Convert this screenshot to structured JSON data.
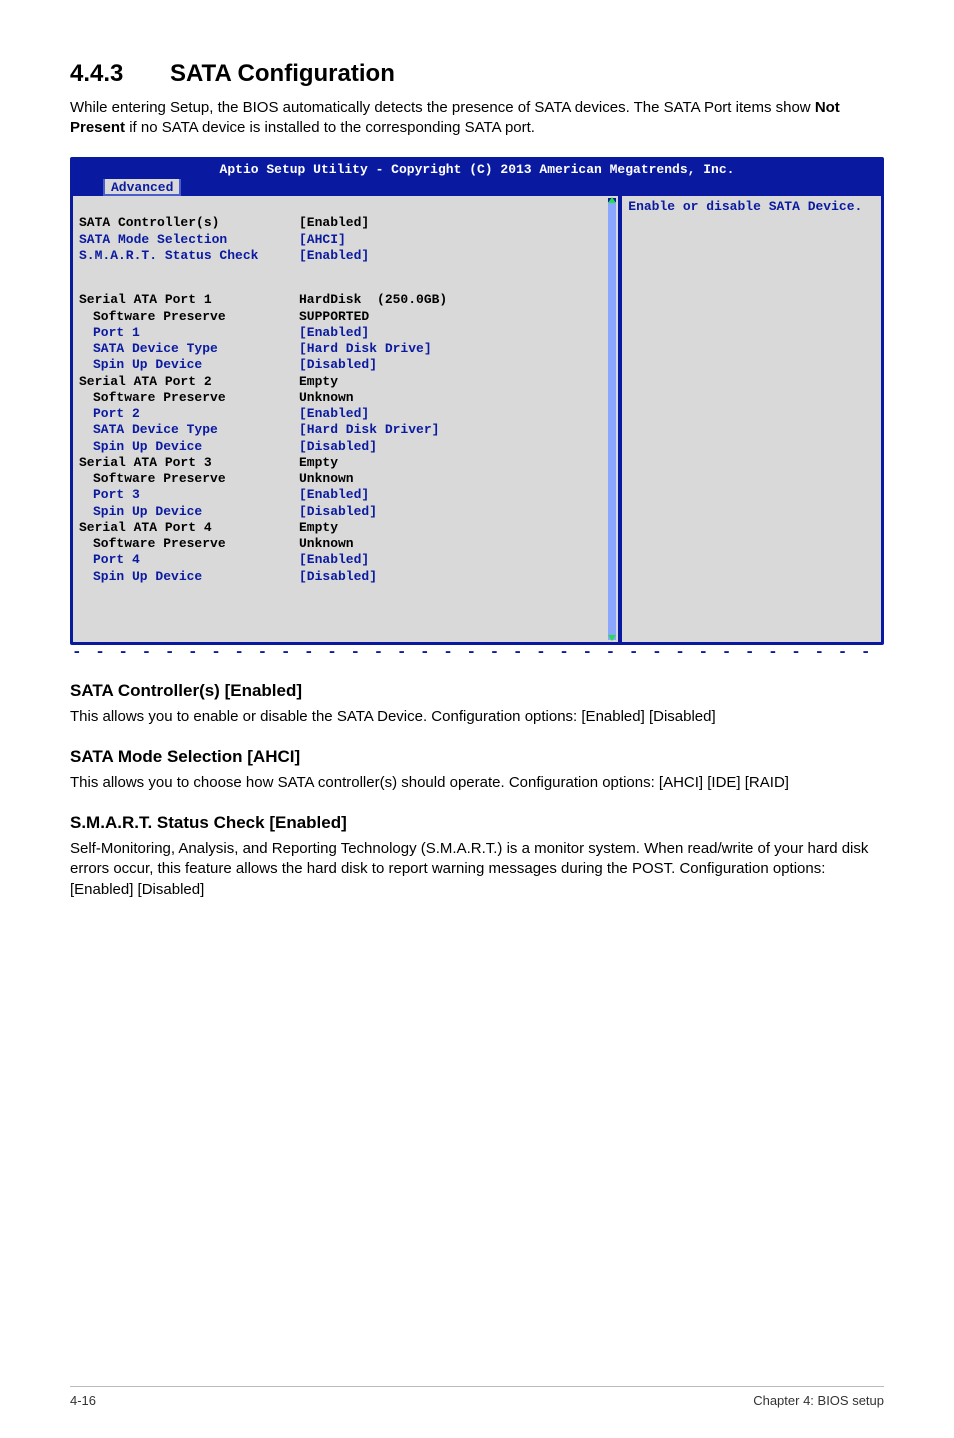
{
  "section": {
    "number": "4.4.3",
    "title": "SATA Configuration"
  },
  "intro": {
    "pre": "While entering Setup, the BIOS automatically detects the presence of SATA devices. The SATA Port items show ",
    "bold": "Not Present",
    "post": " if no SATA device is installed to the corresponding SATA port."
  },
  "bios": {
    "header": "Aptio Setup Utility - Copyright (C) 2013 American Megatrends, Inc.",
    "tab": "Advanced",
    "help": "Enable or disable SATA Device.",
    "top_items": [
      {
        "label": "SATA Controller(s)",
        "value": "[Enabled]",
        "hl": true
      },
      {
        "label": "SATA Mode Selection",
        "value": "[AHCI]",
        "hl": false
      },
      {
        "label": "S.M.A.R.T. Status Check",
        "value": "[Enabled]",
        "hl": false
      }
    ],
    "ports": [
      {
        "header": "Serial ATA Port 1",
        "header_value": "HardDisk  (250.0GB)",
        "rows": [
          {
            "label": "Software Preserve",
            "value": "SUPPORTED",
            "blue": false
          },
          {
            "label": "Port 1",
            "value": "[Enabled]",
            "blue": true
          },
          {
            "label": "SATA Device Type",
            "value": "[Hard Disk Drive]",
            "blue": true
          },
          {
            "label": "Spin Up Device",
            "value": "[Disabled]",
            "blue": true
          }
        ]
      },
      {
        "header": "Serial ATA Port 2",
        "header_value": "Empty",
        "rows": [
          {
            "label": "Software Preserve",
            "value": "Unknown",
            "blue": false
          },
          {
            "label": "Port 2",
            "value": "[Enabled]",
            "blue": true
          },
          {
            "label": "SATA Device Type",
            "value": "[Hard Disk Driver]",
            "blue": true
          },
          {
            "label": "Spin Up Device",
            "value": "[Disabled]",
            "blue": true
          }
        ]
      },
      {
        "header": "Serial ATA Port 3",
        "header_value": "Empty",
        "rows": [
          {
            "label": "Software Preserve",
            "value": "Unknown",
            "blue": false
          },
          {
            "label": "Port 3",
            "value": "[Enabled]",
            "blue": true
          },
          {
            "label": "Spin Up Device",
            "value": "[Disabled]",
            "blue": true
          }
        ]
      },
      {
        "header": "Serial ATA Port 4",
        "header_value": "Empty",
        "rows": [
          {
            "label": "Software Preserve",
            "value": "Unknown",
            "blue": false
          },
          {
            "label": "Port 4",
            "value": "[Enabled]",
            "blue": true
          },
          {
            "label": "Spin Up Device",
            "value": "[Disabled]",
            "blue": true
          }
        ]
      }
    ]
  },
  "subsections": [
    {
      "title": "SATA Controller(s) [Enabled]",
      "desc": "This allows you to enable or disable the SATA Device. Configuration options: [Enabled] [Disabled]"
    },
    {
      "title": "SATA Mode Selection [AHCI]",
      "desc": "This allows you to choose how SATA controller(s) should operate. Configuration options: [AHCI] [IDE] [RAID]"
    },
    {
      "title": "S.M.A.R.T. Status Check [Enabled]",
      "desc": "Self-Monitoring, Analysis, and Reporting Technology (S.M.A.R.T.) is a monitor system. When read/write of your hard disk errors occur, this feature allows the hard disk to report warning messages during the POST. Configuration options: [Enabled] [Disabled]"
    }
  ],
  "footer": {
    "left": "4-16",
    "right": "Chapter 4: BIOS setup"
  },
  "dashes": "- - - - - - - - - - - - - - - - - - - - - - - - - - - - - - - - - - - - - - - - - - - - - - - - - - - -"
}
